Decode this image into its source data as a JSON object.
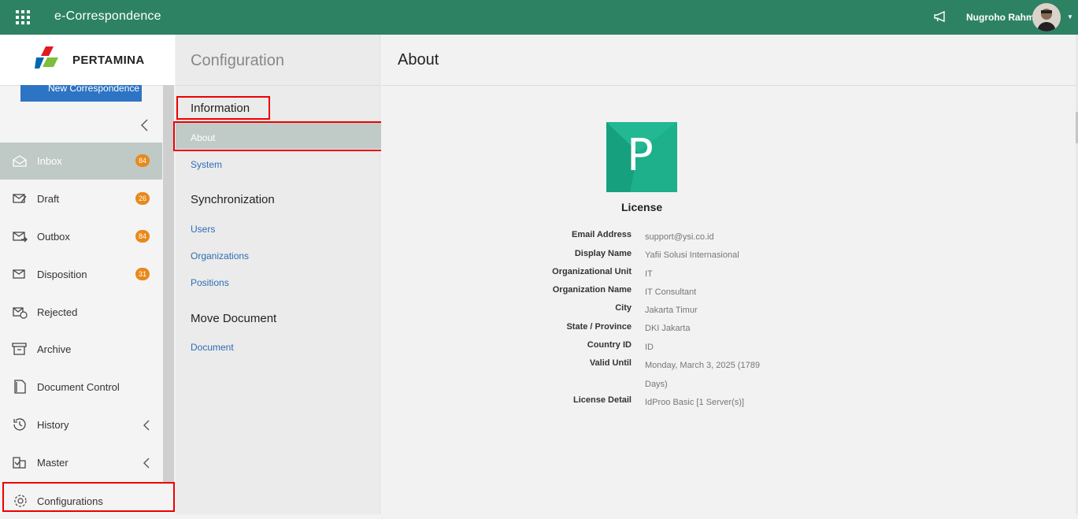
{
  "topbar": {
    "app_title": "e-Correspondence",
    "user_name": "Nugroho Rahm",
    "accent": "#2e8264"
  },
  "sidebar": {
    "brand": "PERTAMINA",
    "new_button_label": "New Correspondence",
    "items": [
      {
        "label": "Inbox",
        "badge": "84",
        "icon": "inbox-icon"
      },
      {
        "label": "Draft",
        "badge": "26",
        "icon": "draft-icon"
      },
      {
        "label": "Outbox",
        "badge": "84",
        "icon": "outbox-icon"
      },
      {
        "label": "Disposition",
        "badge": "31",
        "icon": "disposition-icon"
      },
      {
        "label": "Rejected",
        "icon": "rejected-icon"
      },
      {
        "label": "Archive",
        "icon": "archive-icon"
      },
      {
        "label": "Document Control",
        "icon": "document-control-icon"
      },
      {
        "label": "History",
        "icon": "history-icon"
      },
      {
        "label": "Master",
        "icon": "master-icon"
      },
      {
        "label": "Configurations",
        "icon": "gear-icon"
      }
    ]
  },
  "config": {
    "title": "Configuration",
    "sections": [
      {
        "title": "Information",
        "links": [
          "About",
          "System"
        ]
      },
      {
        "title": "Synchronization",
        "links": [
          "Users",
          "Organizations",
          "Positions"
        ]
      },
      {
        "title": "Move Document",
        "links": [
          "Document"
        ]
      }
    ]
  },
  "about": {
    "title": "About",
    "logo_letter": "P",
    "license_title": "License",
    "rows": [
      {
        "key": "Email Address",
        "value": "support@ysi.co.id"
      },
      {
        "key": "Display Name",
        "value": "Yafii Solusi Internasional"
      },
      {
        "key": "Organizational Unit",
        "value": "IT"
      },
      {
        "key": "Organization Name",
        "value": "IT Consultant"
      },
      {
        "key": "City",
        "value": "Jakarta Timur"
      },
      {
        "key": "State / Province",
        "value": "DKI Jakarta"
      },
      {
        "key": "Country ID",
        "value": "ID"
      },
      {
        "key": "Valid Until",
        "value": "Monday, March 3, 2025 (1789",
        "value2": "Days)"
      },
      {
        "key": "License Detail",
        "value": "IdProo Basic [1 Server(s)]"
      }
    ]
  }
}
